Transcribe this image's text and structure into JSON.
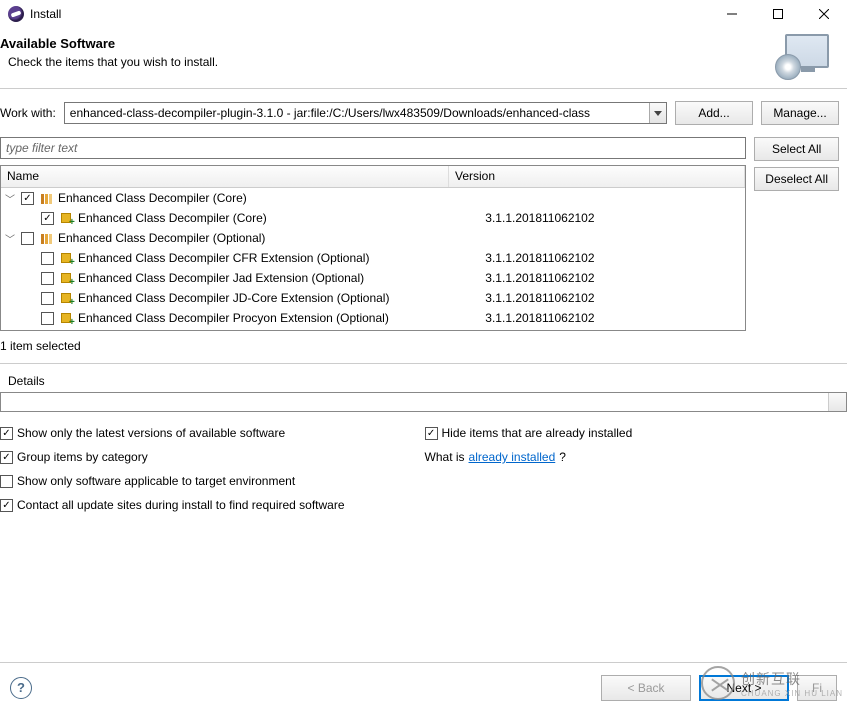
{
  "window": {
    "title": "Install"
  },
  "header": {
    "title": "Available Software",
    "subtitle": "Check the items that you wish to install."
  },
  "workwith": {
    "label": "Work with:",
    "value": "enhanced-class-decompiler-plugin-3.1.0 - jar:file:/C:/Users/lwx483509/Downloads/enhanced-class",
    "add": "Add...",
    "manage": "Manage..."
  },
  "filter": {
    "placeholder": "type filter text"
  },
  "sidebuttons": {
    "selectall": "Select All",
    "deselectall": "Deselect All"
  },
  "columns": {
    "name": "Name",
    "version": "Version"
  },
  "tree": {
    "cat1": {
      "label": "Enhanced Class Decompiler (Core)",
      "items": [
        {
          "label": "Enhanced Class Decompiler (Core)",
          "version": "3.1.1.201811062102"
        }
      ]
    },
    "cat2": {
      "label": "Enhanced Class Decompiler (Optional)",
      "items": [
        {
          "label": "Enhanced Class Decompiler CFR Extension (Optional)",
          "version": "3.1.1.201811062102"
        },
        {
          "label": "Enhanced Class Decompiler Jad Extension (Optional)",
          "version": "3.1.1.201811062102"
        },
        {
          "label": "Enhanced Class Decompiler JD-Core Extension (Optional)",
          "version": "3.1.1.201811062102"
        },
        {
          "label": "Enhanced Class Decompiler Procyon Extension (Optional)",
          "version": "3.1.1.201811062102"
        }
      ]
    }
  },
  "status": "1 item selected",
  "details": {
    "label": "Details"
  },
  "options": {
    "latest": "Show only the latest versions of available software",
    "group": "Group items by category",
    "target": "Show only software applicable to target environment",
    "contact": "Contact all update sites during install to find required software",
    "hide": "Hide items that are already installed",
    "whatis_pre": "What is ",
    "whatis_link": "already installed",
    "whatis_post": "?"
  },
  "footer": {
    "back": "< Back",
    "next": "Next >",
    "finish": "Fi"
  },
  "watermark": {
    "brand": "创新互联",
    "sub": "CHUANG XIN HU LIAN"
  }
}
